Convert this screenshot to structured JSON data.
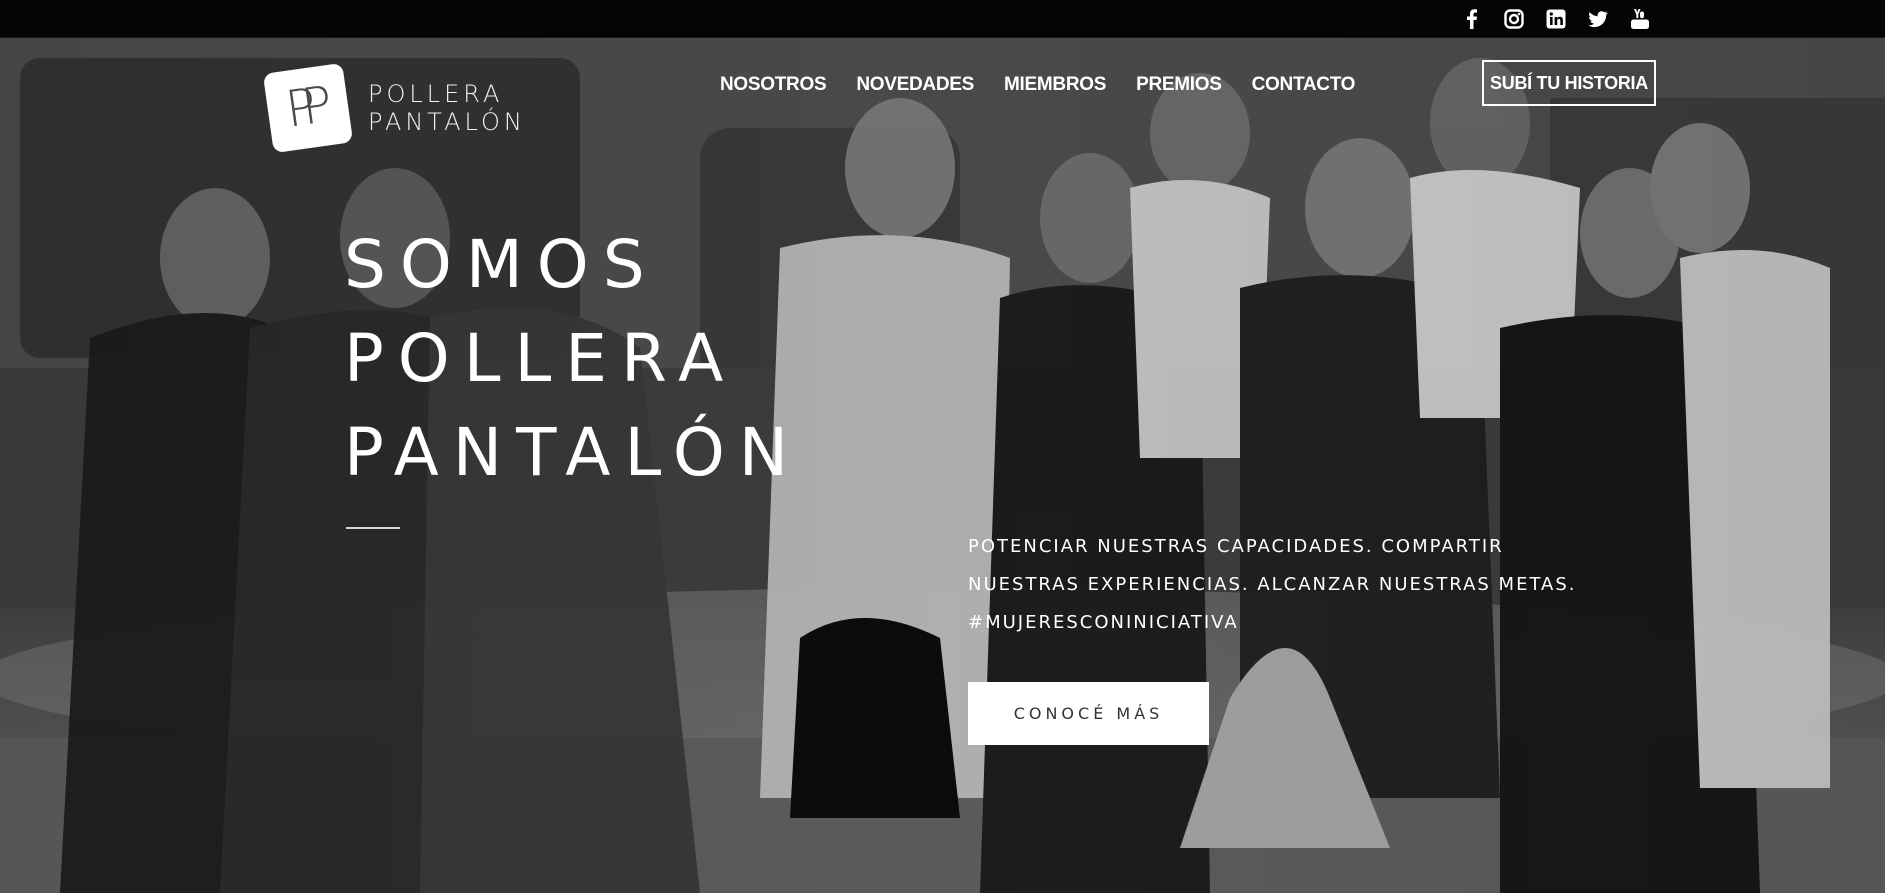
{
  "social": {
    "icons": [
      "facebook-icon",
      "instagram-icon",
      "linkedin-icon",
      "twitter-icon",
      "youtube-icon"
    ]
  },
  "brand": {
    "mark": "PP",
    "line1": "POLLERA",
    "line2": "PANTALÓN"
  },
  "nav": {
    "items": [
      "NOSOTROS",
      "NOVEDADES",
      "MIEMBROS",
      "PREMIOS",
      "CONTACTO"
    ],
    "cta": "SUBÍ TU HISTORIA"
  },
  "hero": {
    "headline": [
      "SOMOS",
      "POLLERA",
      "PANTALÓN"
    ],
    "tagline": [
      "POTENCIAR NUESTRAS CAPACIDADES. COMPARTIR",
      "NUESTRAS EXPERIENCIAS. ALCANZAR NUESTRAS METAS.",
      "#MUJERESCONINICIATIVA"
    ],
    "button": "CONOCÉ MÁS"
  }
}
